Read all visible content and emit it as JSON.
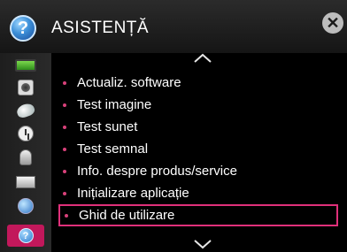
{
  "header": {
    "title": "ASISTENȚĂ",
    "help_glyph": "?",
    "close_glyph": "✕"
  },
  "sidebar": {
    "items": [
      {
        "icon": "picture-icon"
      },
      {
        "icon": "sound-icon"
      },
      {
        "icon": "channels-icon"
      },
      {
        "icon": "time-icon"
      },
      {
        "icon": "lock-icon"
      },
      {
        "icon": "options-icon"
      },
      {
        "icon": "network-icon"
      },
      {
        "icon": "help-icon",
        "glyph": "?",
        "selected": true
      }
    ]
  },
  "menu": {
    "items": [
      {
        "label": "Actualiz. software"
      },
      {
        "label": "Test imagine"
      },
      {
        "label": "Test sunet"
      },
      {
        "label": "Test semnal"
      },
      {
        "label": "Info. despre produs/service"
      },
      {
        "label": "Inițializare aplicație"
      },
      {
        "label": "Ghid de utilizare",
        "selected": true
      }
    ]
  },
  "colors": {
    "accent": "#e0307a",
    "bullet": "#d8417a",
    "background": "#000000",
    "text": "#ffffff"
  }
}
